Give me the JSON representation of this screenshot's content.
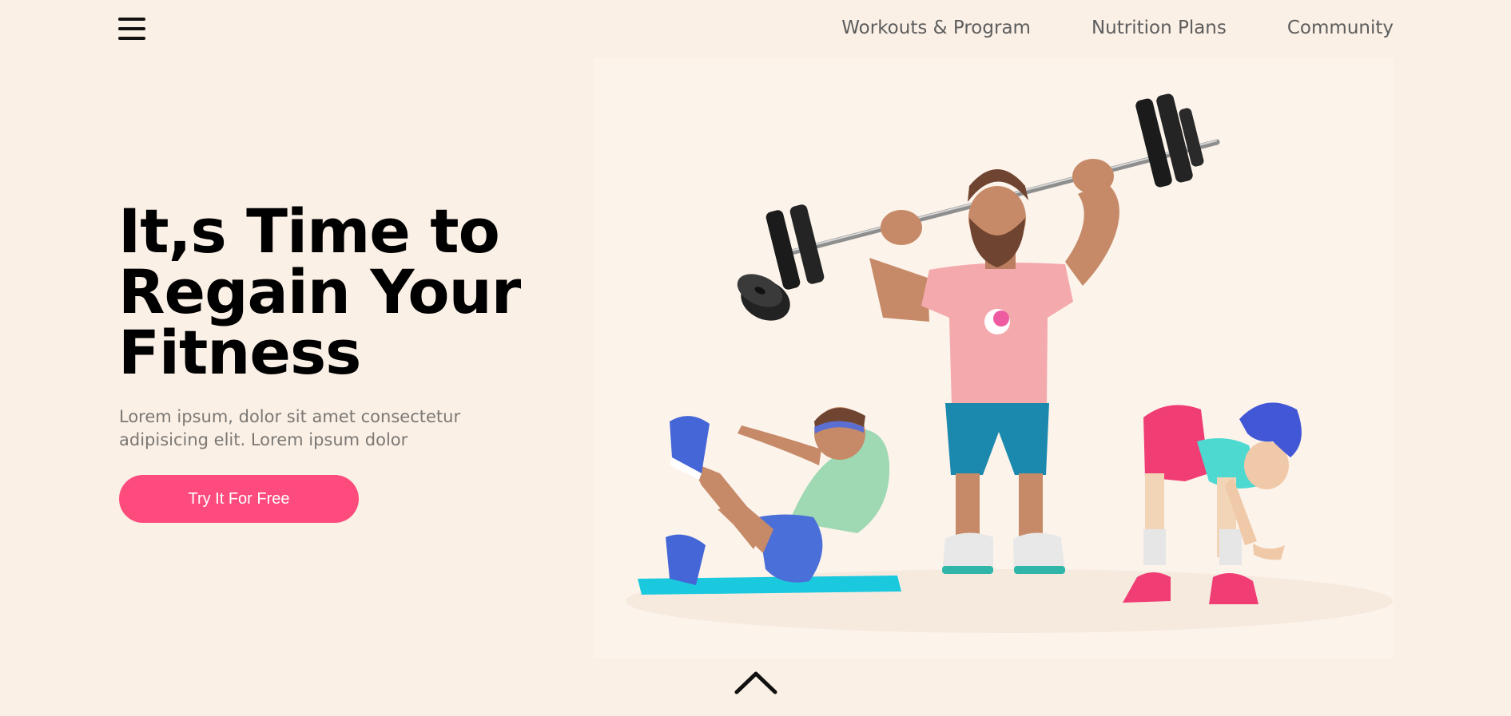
{
  "header": {
    "menu_icon": "hamburger-menu-icon",
    "nav": [
      {
        "label": "Workouts & Program"
      },
      {
        "label": "Nutrition Plans"
      },
      {
        "label": "Community"
      }
    ]
  },
  "hero": {
    "title_lines": [
      "It,s Time to",
      "Regain Your",
      "Fitness"
    ],
    "subtitle_lines": [
      "Lorem ipsum, dolor sit amet consectetur",
      "adipisicing elit. Lorem ipsum dolor"
    ],
    "cta_label": "Try It For Free"
  },
  "footer": {
    "scroll_icon": "chevron-up-icon"
  },
  "colors": {
    "background": "#faf0e6",
    "accent": "#fe4b7d",
    "heading": "#000000",
    "nav_text": "#5d5d5d",
    "body_text": "#7b7874"
  }
}
